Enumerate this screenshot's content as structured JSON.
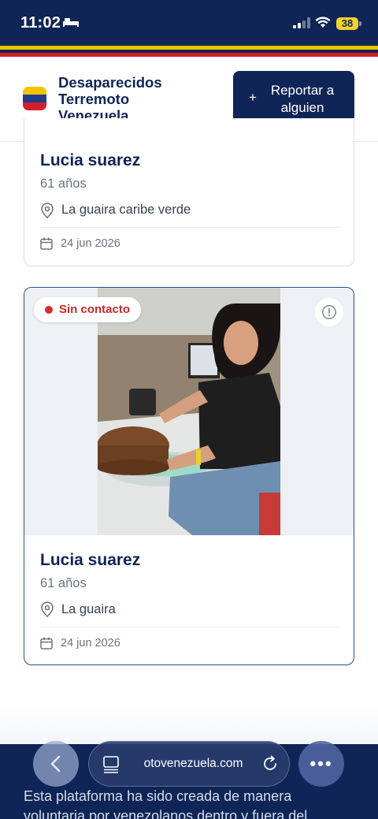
{
  "status_bar": {
    "time": "11:02",
    "battery": "38"
  },
  "header": {
    "brand_line1": "Desaparecidos",
    "brand_line2": "Terremoto",
    "brand_line3": "Venezuela",
    "report_plus": "+",
    "report_label": "Reportar a alguien"
  },
  "flag_colors": {
    "yellow": "#f2c300",
    "blue": "#0f2557",
    "red": "#d31f2d"
  },
  "cards": [
    {
      "name": "Lucia suarez",
      "age": "61 años",
      "location": "La guaira caribe verde",
      "date": "24 jun 2026"
    },
    {
      "status": "Sin contacto",
      "name": "Lucia suarez",
      "age": "61 años",
      "location": "La guaira",
      "date": "24 jun 2026"
    }
  ],
  "footer": {
    "text": "Esta plataforma ha sido creada de manera voluntaria por venezolanos dentro y fuera del"
  },
  "browser": {
    "url": "otovenezuela.com"
  },
  "icons": {
    "flag": "venezuela-flag-icon",
    "location": "map-pin-icon",
    "calendar": "calendar-icon",
    "info": "alert-circle-icon",
    "back": "chevron-left-icon",
    "tabs": "tab-overview-icon",
    "reload": "reload-icon",
    "more": "more-horizontal-icon"
  }
}
